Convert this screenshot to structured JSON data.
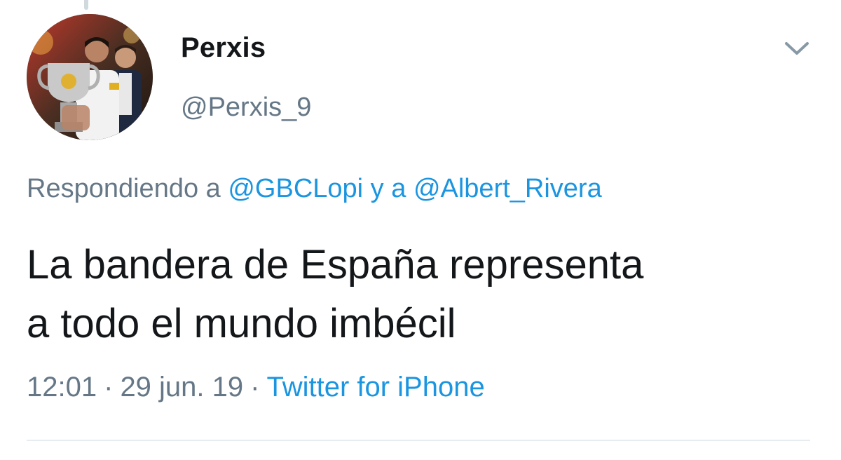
{
  "tweet": {
    "author": {
      "display_name": "Perxis",
      "handle": "@Perxis_9",
      "avatar": "profile-photo"
    },
    "replying": {
      "prefix": "Respondiendo a",
      "mention1": "@GBCLopi",
      "connector": "y a",
      "mention2": "@Albert_Rivera"
    },
    "text_line1": "La bandera de España representa",
    "text_line2": "a todo el mundo imbécil",
    "time": "12:01",
    "separator": "·",
    "date": "29 jun. 19",
    "source": "Twitter for iPhone",
    "menu_icon": "chevron-down-icon"
  },
  "colors": {
    "text": "#14171a",
    "secondary": "#657786",
    "link": "#1b95e0",
    "divider": "#e6ecf0"
  }
}
